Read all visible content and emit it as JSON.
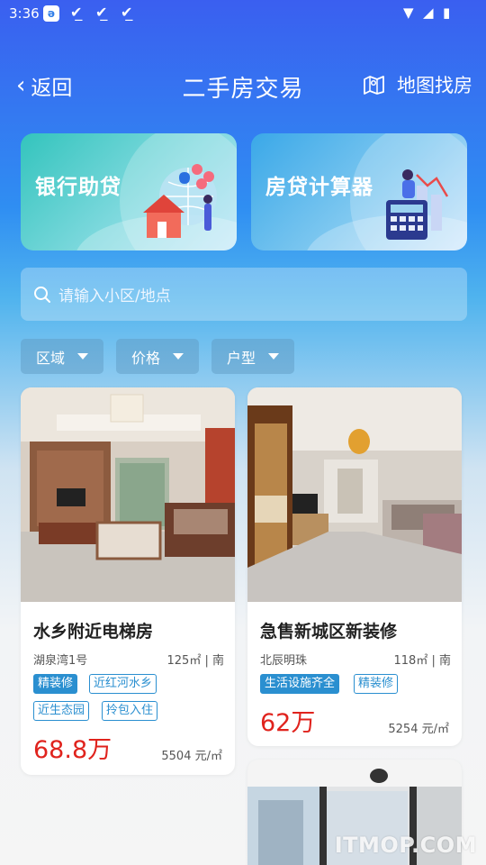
{
  "status_bar": {
    "time": "3:36"
  },
  "header": {
    "back_label": "返回",
    "title": "二手房交易",
    "map_label": "地图找房"
  },
  "features": [
    {
      "label": "银行助贷"
    },
    {
      "label": "房贷计算器"
    }
  ],
  "search": {
    "placeholder": "请输入小区/地点"
  },
  "filters": [
    "区域",
    "价格",
    "户型"
  ],
  "listings": [
    {
      "name": "水乡附近电梯房",
      "community": "湖泉湾1号",
      "area": "125㎡",
      "orientation": "南",
      "tags": [
        "精装修",
        "近红河水乡",
        "近生态园",
        "拎包入住"
      ],
      "price": "68.8万",
      "unit_price": "5504 元/㎡"
    },
    {
      "name": "急售新城区新装修",
      "community": "北辰明珠",
      "area": "118㎡",
      "orientation": "南",
      "tags": [
        "生活设施齐全",
        "精装修"
      ],
      "price": "62万",
      "unit_price": "5254 元/㎡"
    }
  ],
  "watermark": "ITMOP.COM",
  "colors": {
    "accent_blue": "#2a8fd0",
    "price_red": "#e0231d"
  }
}
